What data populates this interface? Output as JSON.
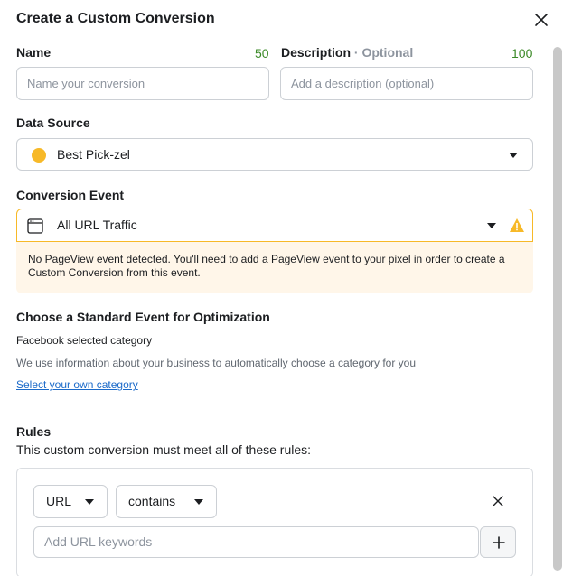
{
  "dialog": {
    "title": "Create a Custom Conversion"
  },
  "name_field": {
    "label": "Name",
    "counter": "50",
    "placeholder": "Name your conversion"
  },
  "description_field": {
    "label": "Description",
    "optional_tag": "· Optional",
    "counter": "100",
    "placeholder": "Add a description (optional)"
  },
  "data_source": {
    "label": "Data Source",
    "selected": "Best Pick-zel",
    "dot_color": "#f7b928"
  },
  "conversion_event": {
    "label": "Conversion Event",
    "selected": "All URL Traffic",
    "warning_text": "No PageView event detected. You'll need to add a PageView event to your pixel in order to create a Custom Conversion from this event."
  },
  "standard_event": {
    "title": "Choose a Standard Event for Optimization",
    "category_label": "Facebook selected category",
    "info_text": "We use information about your business to automatically choose a category for you",
    "link_text": "Select your own category"
  },
  "rules": {
    "title": "Rules",
    "subtitle": "This custom conversion must meet all of these rules:",
    "field_select": "URL",
    "operator_select": "contains",
    "keyword_placeholder": "Add URL keywords"
  },
  "colors": {
    "warning_bg": "#fff6e9",
    "warning_border": "#f7b928",
    "counter_green": "#3b8a27",
    "link_blue": "#1b6ac9"
  }
}
